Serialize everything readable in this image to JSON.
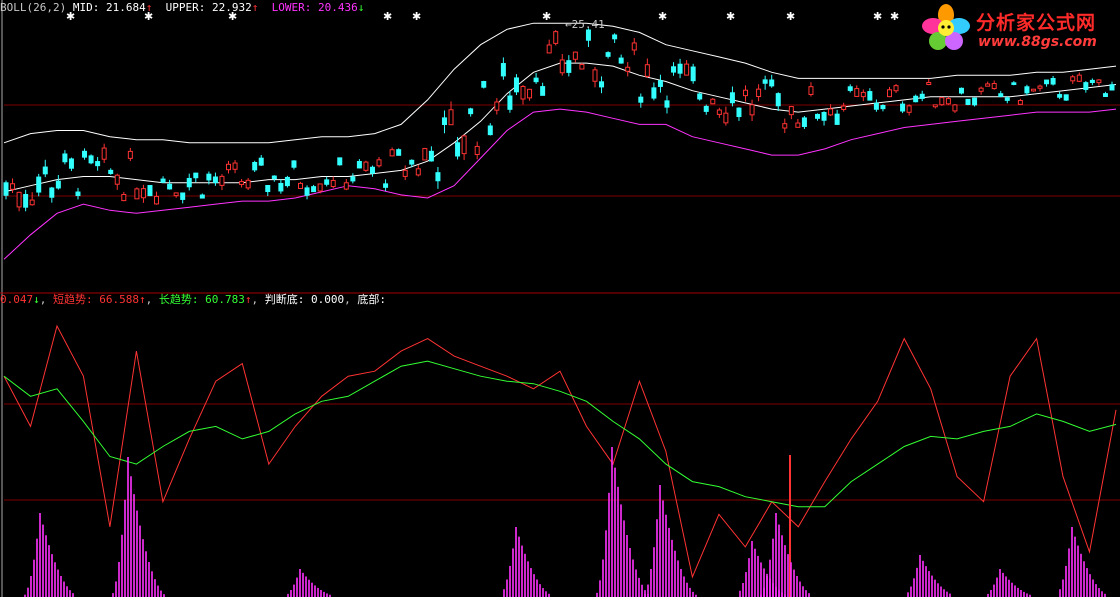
{
  "top_legend": {
    "indicator": "BOLL(26,2)",
    "mid_label": "MID: ",
    "mid_value": "21.684",
    "mid_arrow": "↑",
    "upper_label": "UPPER: ",
    "upper_value": "22.932",
    "upper_arrow": "↑",
    "lower_label": "LOWER: ",
    "lower_value": "20.436",
    "lower_arrow": "↓"
  },
  "bottom_legend": {
    "first_value": "0.047",
    "first_arrow": "↓",
    "short_label": "短趋势: ",
    "short_value": "66.588",
    "short_arrow": "↑",
    "long_label": "长趋势: ",
    "long_value": "60.783",
    "long_arrow": "↑",
    "judge_label": "判断底: ",
    "judge_value": "0.000",
    "bottom_label": "底部:"
  },
  "annotation": {
    "max_price": "25.41"
  },
  "logo": {
    "title": "分析家公式网",
    "url": "www.88gs.com"
  },
  "colors": {
    "background": "#000000",
    "up_candle": "#ff3333",
    "down_candle": "#33ffff",
    "boll_mid_upper": "#ffffff",
    "boll_lower": "#ff33ff",
    "short_trend": "#ff3333",
    "long_trend": "#33ff33",
    "bottom_histogram": "#ff33ff",
    "grid": "#800000"
  },
  "chart_data": [
    {
      "type": "line",
      "title": "BOLL(26,2)",
      "series": [
        {
          "name": "MID",
          "values": [
            20.2,
            20.4,
            20.6,
            20.7,
            20.7,
            20.6,
            20.5,
            20.5,
            20.5,
            20.5,
            20.6,
            20.6,
            20.7,
            20.7,
            20.8,
            20.9,
            21.2,
            21.8,
            22.5,
            23.4,
            24.1,
            24.4,
            24.4,
            24.3,
            24.0,
            23.8,
            23.5,
            23.3,
            23.1,
            22.9,
            22.8,
            22.9,
            23.0,
            23.1,
            23.2,
            23.3,
            23.3,
            23.3,
            23.3,
            23.4,
            23.5,
            23.6,
            23.7
          ]
        },
        {
          "name": "UPPER",
          "values": [
            21.8,
            22.1,
            22.2,
            22.2,
            22.0,
            21.9,
            21.9,
            21.8,
            21.8,
            21.8,
            21.8,
            21.9,
            22.0,
            22.0,
            22.1,
            22.4,
            23.2,
            24.2,
            25.0,
            25.5,
            25.7,
            25.7,
            25.7,
            25.6,
            25.4,
            25.0,
            24.8,
            24.6,
            24.4,
            24.1,
            23.9,
            23.9,
            23.9,
            23.9,
            23.9,
            23.9,
            24.0,
            24.0,
            24.0,
            24.1,
            24.1,
            24.2,
            24.3
          ]
        },
        {
          "name": "LOWER",
          "values": [
            18.0,
            18.8,
            19.5,
            19.8,
            19.6,
            19.5,
            19.6,
            19.7,
            19.8,
            19.9,
            19.9,
            20.0,
            20.2,
            20.4,
            20.3,
            20.1,
            20.0,
            20.4,
            21.3,
            22.2,
            22.8,
            22.9,
            22.8,
            22.6,
            22.4,
            22.4,
            22.0,
            21.8,
            21.6,
            21.4,
            21.4,
            21.6,
            21.9,
            22.1,
            22.3,
            22.4,
            22.5,
            22.6,
            22.7,
            22.8,
            22.8,
            22.8,
            22.9
          ]
        }
      ],
      "max_label": "25.41"
    },
    {
      "type": "line",
      "series": [
        {
          "name": "短趋势",
          "values": [
            80,
            60,
            100,
            80,
            20,
            90,
            30,
            55,
            78,
            85,
            45,
            60,
            72,
            80,
            82,
            90,
            95,
            88,
            84,
            80,
            75,
            82,
            60,
            45,
            78,
            50,
            0,
            25,
            12,
            30,
            20,
            38,
            55,
            70,
            95,
            75,
            40,
            30,
            80,
            95,
            40,
            10,
            66.588
          ]
        },
        {
          "name": "长趋势",
          "values": [
            80,
            72,
            75,
            62,
            48,
            45,
            52,
            58,
            60,
            55,
            58,
            65,
            70,
            72,
            78,
            84,
            86,
            83,
            80,
            78,
            77,
            74,
            70,
            62,
            55,
            45,
            38,
            36,
            32,
            30,
            28,
            28,
            38,
            45,
            52,
            56,
            55,
            58,
            60,
            65,
            62,
            58,
            60.783
          ]
        }
      ],
      "bottom_peaks": [
        6,
        10,
        2,
        5,
        12,
        8,
        4,
        6,
        3,
        2,
        5
      ]
    }
  ]
}
